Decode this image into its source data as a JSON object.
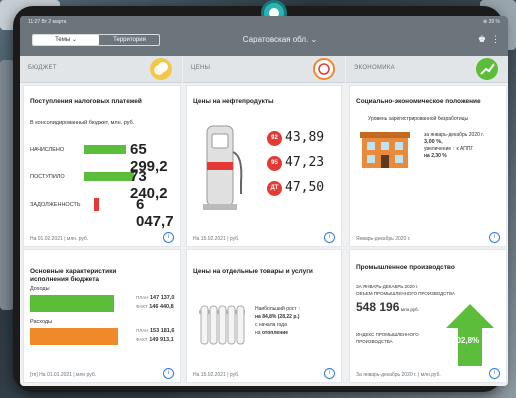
{
  "status": {
    "time": "11:27  Вт 2 марта",
    "battery": "⊕ 39 %"
  },
  "topbar": {
    "tabs": [
      {
        "label": "Темы",
        "caret": "⌄"
      },
      {
        "label": "Территория"
      }
    ],
    "region": "Саратовская обл.",
    "region_caret": "⌄"
  },
  "columns": {
    "budget": {
      "title": "БЮДЖЕТ"
    },
    "prices": {
      "title": "ЦЕНЫ"
    },
    "economy": {
      "title": "ЭКОНОМИКА"
    }
  },
  "tax": {
    "title": "Поступления налоговых платежей",
    "subtitle": "В консолидированный бюджет, млн. руб.",
    "rows": [
      {
        "label": "НАЧИСЛЕНО",
        "value": "65 299,2",
        "share": 0.84
      },
      {
        "label": "ПОСТУПИЛО",
        "value": "73 240,2",
        "share": 1.0
      },
      {
        "label": "ЗАДОЛЖЕННОСТЬ",
        "value": "6 047,7",
        "share": 0.08
      }
    ],
    "footer": "На 01.02.2021 | млн. руб."
  },
  "budget_chars": {
    "title_line1": "Основные характеристики",
    "title_line2": "исполнения бюджета",
    "income_label": "Доходы",
    "income_plan_label": "ПЛАН",
    "income_plan": "147 137,0",
    "income_fact_label": "ФАКТ",
    "income_fact": "146 440,8",
    "expense_label": "Расходы",
    "expense_plan_label": "ПЛАН",
    "expense_plan": "153 181,6",
    "expense_fact_label": "ФАКТ",
    "expense_fact": "149 913,1",
    "footer": "[тп] На 01.01.2021 | млн руб."
  },
  "fuel": {
    "title": "Цены на нефтепродукты",
    "items": [
      {
        "grade": "92",
        "price": "43,89"
      },
      {
        "grade": "95",
        "price": "47,23"
      },
      {
        "grade": "ДТ",
        "price": "47,50"
      }
    ],
    "footer": "На 15.02.2021 | руб."
  },
  "goods": {
    "title": "Цены на отдельные товары и услуги",
    "text_line1": "Наибольший рост",
    "text_line2": "на 84,8% (28,22 р.)",
    "text_line3": "с начала года",
    "text_line4_prefix": "на ",
    "text_line4_bold": "отопление",
    "footer": "На 15.02.2021 | руб."
  },
  "social": {
    "title": "Социально-экономическое положение",
    "text_line1": "Уровень зарегистрированной безработицы",
    "text_line2": "за январь-декабрь 2020 г.",
    "rate": "3,00 %,",
    "text_line3": "увеличение",
    "text_line3b": "к АППГ",
    "delta": "на 2,30 %",
    "footer": "Январь-декабрь 2020 г."
  },
  "industry": {
    "title": "Промышленное производство",
    "line1": "ЗА ЯНВАРЬ-ДЕКАБРЬ 2020 г.",
    "line2": "ОБЪЕМ ПРОМЫШЛЕННОГО ПРОИЗВОДСТВА",
    "volume": "548 196",
    "volume_unit": "млн.руб.",
    "index_line1": "ИНДЕКС ПРОМЫШЛЕННОГО",
    "index_line2": "ПРОИЗВОДСТВА",
    "index": "102,8%",
    "footer": "За январь-декабрь 2020 г. | млн.руб."
  },
  "colors": {
    "green": "#5cbd3b",
    "red": "#e53935",
    "orange": "#f0892a",
    "accent": "#3a7bd5"
  }
}
